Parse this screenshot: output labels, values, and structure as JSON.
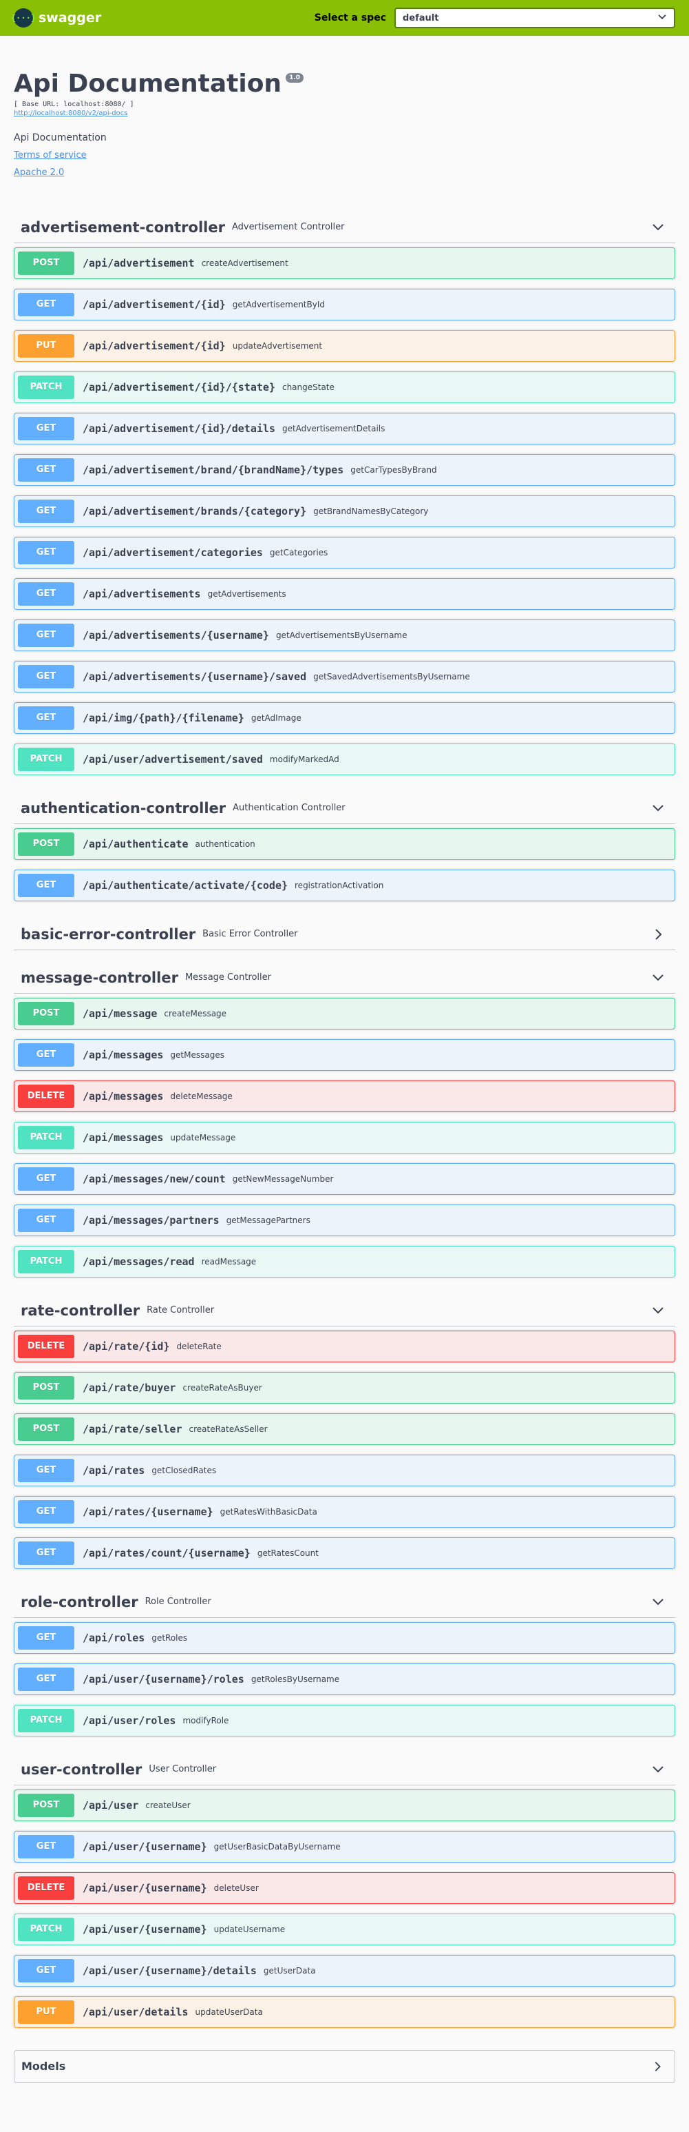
{
  "topbar": {
    "logo_text": "swagger",
    "logo_mark": "{···}",
    "spec_label": "Select a spec",
    "spec_value": "default",
    "colors": {
      "background": "#89bf04"
    }
  },
  "info": {
    "title": "Api Documentation",
    "version": "1.0",
    "base_url": "[ Base URL: localhost:8080/ ]",
    "api_docs_link": "http://localhost:8080/v2/api-docs",
    "description": "Api Documentation",
    "terms_link": "Terms of service",
    "license_link": "Apache 2.0"
  },
  "method_colors": {
    "POST": "#49cc90",
    "GET": "#61affe",
    "PUT": "#fca130",
    "PATCH": "#50e3c2",
    "DELETE": "#f93e3e"
  },
  "controllers": [
    {
      "name": "advertisement-controller",
      "description": "Advertisement Controller",
      "expanded": true,
      "operations": [
        {
          "method": "POST",
          "path": "/api/advertisement",
          "summary": "createAdvertisement"
        },
        {
          "method": "GET",
          "path": "/api/advertisement/{id}",
          "summary": "getAdvertisementById"
        },
        {
          "method": "PUT",
          "path": "/api/advertisement/{id}",
          "summary": "updateAdvertisement"
        },
        {
          "method": "PATCH",
          "path": "/api/advertisement/{id}/{state}",
          "summary": "changeState"
        },
        {
          "method": "GET",
          "path": "/api/advertisement/{id}/details",
          "summary": "getAdvertisementDetails"
        },
        {
          "method": "GET",
          "path": "/api/advertisement/brand/{brandName}/types",
          "summary": "getCarTypesByBrand"
        },
        {
          "method": "GET",
          "path": "/api/advertisement/brands/{category}",
          "summary": "getBrandNamesByCategory"
        },
        {
          "method": "GET",
          "path": "/api/advertisement/categories",
          "summary": "getCategories"
        },
        {
          "method": "GET",
          "path": "/api/advertisements",
          "summary": "getAdvertisements"
        },
        {
          "method": "GET",
          "path": "/api/advertisements/{username}",
          "summary": "getAdvertisementsByUsername"
        },
        {
          "method": "GET",
          "path": "/api/advertisements/{username}/saved",
          "summary": "getSavedAdvertisementsByUsername"
        },
        {
          "method": "GET",
          "path": "/api/img/{path}/{filename}",
          "summary": "getAdImage"
        },
        {
          "method": "PATCH",
          "path": "/api/user/advertisement/saved",
          "summary": "modifyMarkedAd"
        }
      ]
    },
    {
      "name": "authentication-controller",
      "description": "Authentication Controller",
      "expanded": true,
      "operations": [
        {
          "method": "POST",
          "path": "/api/authenticate",
          "summary": "authentication"
        },
        {
          "method": "GET",
          "path": "/api/authenticate/activate/{code}",
          "summary": "registrationActivation"
        }
      ]
    },
    {
      "name": "basic-error-controller",
      "description": "Basic Error Controller",
      "expanded": false,
      "operations": []
    },
    {
      "name": "message-controller",
      "description": "Message Controller",
      "expanded": true,
      "operations": [
        {
          "method": "POST",
          "path": "/api/message",
          "summary": "createMessage"
        },
        {
          "method": "GET",
          "path": "/api/messages",
          "summary": "getMessages"
        },
        {
          "method": "DELETE",
          "path": "/api/messages",
          "summary": "deleteMessage"
        },
        {
          "method": "PATCH",
          "path": "/api/messages",
          "summary": "updateMessage"
        },
        {
          "method": "GET",
          "path": "/api/messages/new/count",
          "summary": "getNewMessageNumber"
        },
        {
          "method": "GET",
          "path": "/api/messages/partners",
          "summary": "getMessagePartners"
        },
        {
          "method": "PATCH",
          "path": "/api/messages/read",
          "summary": "readMessage"
        }
      ]
    },
    {
      "name": "rate-controller",
      "description": "Rate Controller",
      "expanded": true,
      "operations": [
        {
          "method": "DELETE",
          "path": "/api/rate/{id}",
          "summary": "deleteRate"
        },
        {
          "method": "POST",
          "path": "/api/rate/buyer",
          "summary": "createRateAsBuyer"
        },
        {
          "method": "POST",
          "path": "/api/rate/seller",
          "summary": "createRateAsSeller"
        },
        {
          "method": "GET",
          "path": "/api/rates",
          "summary": "getClosedRates"
        },
        {
          "method": "GET",
          "path": "/api/rates/{username}",
          "summary": "getRatesWithBasicData"
        },
        {
          "method": "GET",
          "path": "/api/rates/count/{username}",
          "summary": "getRatesCount"
        }
      ]
    },
    {
      "name": "role-controller",
      "description": "Role Controller",
      "expanded": true,
      "operations": [
        {
          "method": "GET",
          "path": "/api/roles",
          "summary": "getRoles"
        },
        {
          "method": "GET",
          "path": "/api/user/{username}/roles",
          "summary": "getRolesByUsername"
        },
        {
          "method": "PATCH",
          "path": "/api/user/roles",
          "summary": "modifyRole"
        }
      ]
    },
    {
      "name": "user-controller",
      "description": "User Controller",
      "expanded": true,
      "operations": [
        {
          "method": "POST",
          "path": "/api/user",
          "summary": "createUser"
        },
        {
          "method": "GET",
          "path": "/api/user/{username}",
          "summary": "getUserBasicDataByUsername"
        },
        {
          "method": "DELETE",
          "path": "/api/user/{username}",
          "summary": "deleteUser"
        },
        {
          "method": "PATCH",
          "path": "/api/user/{username}",
          "summary": "updateUsername"
        },
        {
          "method": "GET",
          "path": "/api/user/{username}/details",
          "summary": "getUserData"
        },
        {
          "method": "PUT",
          "path": "/api/user/details",
          "summary": "updateUserData"
        }
      ]
    }
  ],
  "models": {
    "title": "Models"
  }
}
